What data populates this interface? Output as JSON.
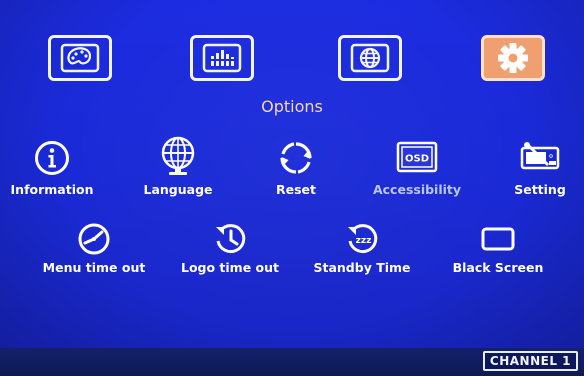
{
  "menu": {
    "tabs": [
      {
        "name": "picture",
        "icon": "palette-icon",
        "active": false
      },
      {
        "name": "audio",
        "icon": "equalizer-icon",
        "active": false
      },
      {
        "name": "network",
        "icon": "globe-icon",
        "active": false
      },
      {
        "name": "options",
        "icon": "gear-icon",
        "active": true
      }
    ],
    "section_title": "Options"
  },
  "options": {
    "row1": [
      {
        "label": "Information",
        "icon": "info-icon"
      },
      {
        "label": "Language",
        "icon": "globe-icon"
      },
      {
        "label": "Reset",
        "icon": "reset-icon"
      },
      {
        "label": "Accessibility",
        "icon": "osd-icon"
      },
      {
        "label": "Setting",
        "icon": "setting-icon"
      }
    ],
    "row2": [
      {
        "label": "Menu time out",
        "icon": "clock-icon"
      },
      {
        "label": "Logo time out",
        "icon": "history-icon"
      },
      {
        "label": "Standby Time",
        "icon": "sleep-icon"
      },
      {
        "label": "Black Screen",
        "icon": "blank-screen-icon"
      }
    ],
    "osd_text": "OSD"
  },
  "status": {
    "channel": "CHANNEL 1"
  },
  "colors": {
    "background": "#1c2ce0",
    "active_tab": "#f0a070",
    "title": "#f6d6b0",
    "dim_label": "#b9c6ff"
  }
}
